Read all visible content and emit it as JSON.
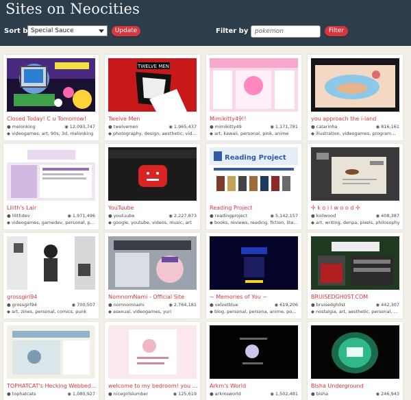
{
  "header": {
    "title": "Sites on Neocities",
    "sort_label": "Sort by:",
    "sort_value": "Special Sauce",
    "update_label": "Update",
    "filter_label": "Filter by Tag:",
    "tag_placeholder": "pokemon",
    "filter_button": "Filter"
  },
  "colors": {
    "header_bg": "#2e3d4a",
    "accent": "#d6363f",
    "page_bg": "#f2efe6"
  },
  "icons": {
    "owner": "user-icon",
    "views": "eye-icon",
    "tags": "tag-icon",
    "dropdown": "chevron-down-icon"
  },
  "sites": [
    {
      "title": "Closed Today! C u Tomorrow!",
      "owner": "melonking",
      "views": "12,093,747",
      "tags": "videogames, art, 90s, 3d, melonking"
    },
    {
      "title": "Twelve Men",
      "owner": "twelvemen",
      "views": "1,965,437",
      "tags": "photography, design, aesthetic, videos, f..."
    },
    {
      "title": "Mimikitty49!!",
      "owner": "mimikitty49",
      "views": "1,171,781",
      "tags": "art, kawaii, personal, pink, anime"
    },
    {
      "title": "you approach the i-land",
      "owner": "catarinha",
      "views": "816,161",
      "tags": "illustration, videogames, programming, a..."
    },
    {
      "title": "Lilith's Lair",
      "owner": "lilithdev",
      "views": "1,971,496",
      "tags": "videogames, gamedev, personal, progra..."
    },
    {
      "title": "YouTuube",
      "owner": "youtuube",
      "views": "2,227,873",
      "tags": "google, youtube, videos, music, art"
    },
    {
      "title": "Reading Project",
      "owner": "readingproject",
      "views": "5,142,157",
      "tags": "books, reviews, reading, fiction, literature"
    },
    {
      "title": "✢ k o i l w o o d ✢",
      "owner": "koilwood",
      "views": "408,387",
      "tags": "art, writing, denpa, pixels, philosophy"
    },
    {
      "title": "grossgirl94",
      "owner": "grossgirl94",
      "views": "700,507",
      "tags": "art, zines, personal, comics, punk"
    },
    {
      "title": "NomnomNami - Official Site",
      "owner": "nomnomnami",
      "views": "2,764,181",
      "tags": "asexual, videogames, yuri"
    },
    {
      "title": "~ Memories of You ~",
      "owner": "velvetblue",
      "views": "619,206",
      "tags": "blog, personal, persona, anime, poetry"
    },
    {
      "title": "BRUISEDGH0ST.COM",
      "owner": "bruisedgh0st",
      "views": "442,307",
      "tags": "nostalgia, art, aesthetic, personal, blog"
    },
    {
      "title": "TOPHATCAT's Hecking Webbed S...",
      "owner": "tophatcats",
      "views": "1,080,927",
      "tags": ""
    },
    {
      "title": "welcome to my bedroom! you j...",
      "owner": "nicegirlslumber",
      "views": "125,619",
      "tags": ""
    },
    {
      "title": "Arkm's World",
      "owner": "arkmsworld",
      "views": "1,502,481",
      "tags": ""
    },
    {
      "title": "Bisha Underground",
      "owner": "bisha",
      "views": "246,943",
      "tags": ""
    }
  ]
}
